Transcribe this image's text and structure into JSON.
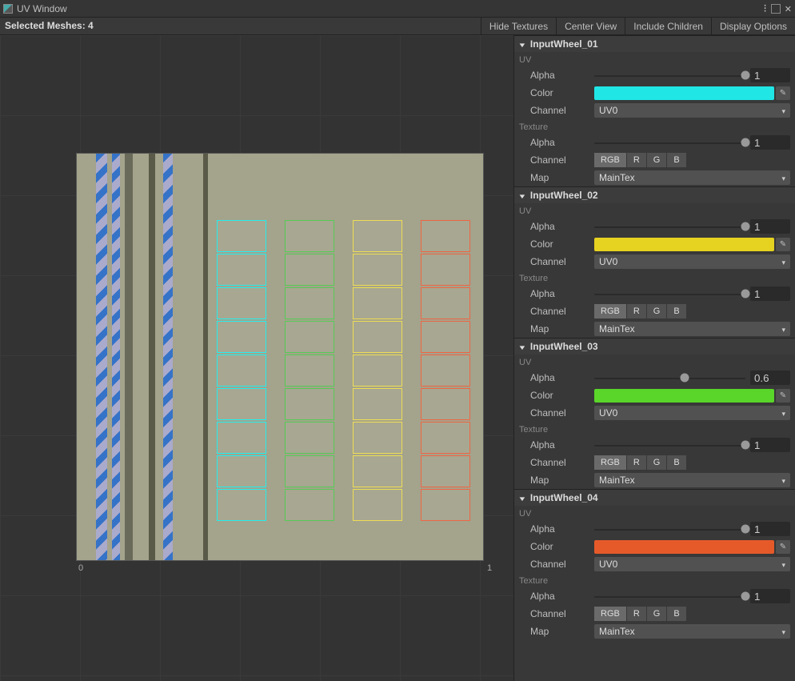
{
  "window": {
    "title": "UV Window"
  },
  "toolbar": {
    "selected_label": "Selected Meshes: 4",
    "hide_textures": "Hide Textures",
    "center_view": "Center View",
    "include_children": "Include Children",
    "display_options": "Display Options"
  },
  "viewport": {
    "zero": "0",
    "one": "1"
  },
  "labels": {
    "uv": "UV",
    "texture": "Texture",
    "alpha": "Alpha",
    "color": "Color",
    "channel": "Channel",
    "map": "Map",
    "rgb": "RGB",
    "r": "R",
    "g": "G",
    "b": "B"
  },
  "meshes": [
    {
      "name": "InputWheel_01",
      "uv": {
        "alpha": 1,
        "alpha_pct": 100,
        "color": "#20e6e6",
        "channel": "UV0"
      },
      "tex": {
        "alpha": 1,
        "alpha_pct": 100,
        "chan": "RGB",
        "map": "MainTex"
      }
    },
    {
      "name": "InputWheel_02",
      "uv": {
        "alpha": 1,
        "alpha_pct": 100,
        "color": "#e6d220",
        "channel": "UV0"
      },
      "tex": {
        "alpha": 1,
        "alpha_pct": 100,
        "chan": "RGB",
        "map": "MainTex"
      }
    },
    {
      "name": "InputWheel_03",
      "uv": {
        "alpha": 0.6,
        "alpha_pct": 60,
        "color": "#5ad52a",
        "channel": "UV0"
      },
      "tex": {
        "alpha": 1,
        "alpha_pct": 100,
        "chan": "RGB",
        "map": "MainTex"
      }
    },
    {
      "name": "InputWheel_04",
      "uv": {
        "alpha": 1,
        "alpha_pct": 100,
        "color": "#e65a2a",
        "channel": "UV0"
      },
      "tex": {
        "alpha": 1,
        "alpha_pct": 100,
        "chan": "RGB",
        "map": "MainTex"
      }
    }
  ]
}
